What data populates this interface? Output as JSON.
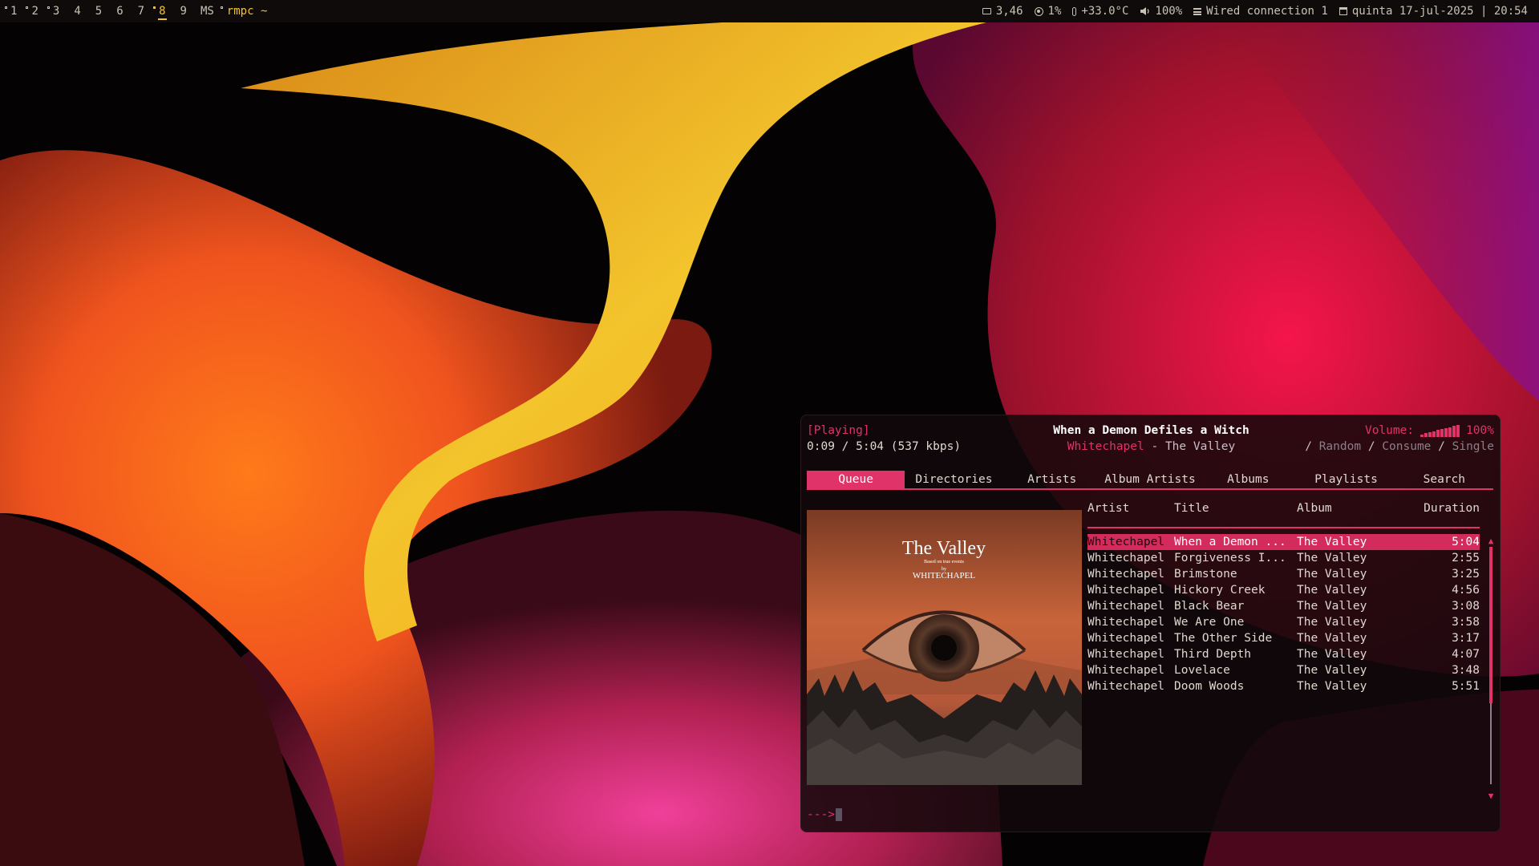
{
  "topbar": {
    "workspaces": [
      "1",
      "2",
      "3",
      "4",
      "5",
      "6",
      "7",
      "8",
      "9"
    ],
    "layout": "MS",
    "window_title": "rmpc ~",
    "memory": "3,46",
    "cpu": "1%",
    "temperature": "+33.0°C",
    "volume": "100%",
    "network": "Wired connection 1",
    "datetime": "quinta 17-jul-2025 | 20:54"
  },
  "player": {
    "state": "[Playing]",
    "elapsed": "0:09 / 5:04 (537 kbps)",
    "song_title": "When a Demon Defiles a Witch",
    "artist": "Whitechapel",
    "separator": " - ",
    "album": "The Valley",
    "volume_label": "Volume:",
    "volume_value": "100%",
    "volume_level": 1.0,
    "flags": {
      "sep": " / ",
      "random": "Random",
      "consume": "Consume",
      "single": "Single"
    }
  },
  "tabs": [
    "Queue",
    "Directories",
    "Artists",
    "Album Artists",
    "Albums",
    "Playlists",
    "Search"
  ],
  "queue": {
    "headers": {
      "artist": "Artist",
      "title": "Title",
      "album": "Album",
      "duration": "Duration"
    },
    "rows": [
      {
        "artist": "Whitechapel",
        "title": "When a Demon ...",
        "album": "The Valley",
        "duration": "5:04"
      },
      {
        "artist": "Whitechapel",
        "title": "Forgiveness I...",
        "album": "The Valley",
        "duration": "2:55"
      },
      {
        "artist": "Whitechapel",
        "title": "Brimstone",
        "album": "The Valley",
        "duration": "3:25"
      },
      {
        "artist": "Whitechapel",
        "title": "Hickory Creek",
        "album": "The Valley",
        "duration": "4:56"
      },
      {
        "artist": "Whitechapel",
        "title": "Black Bear",
        "album": "The Valley",
        "duration": "3:08"
      },
      {
        "artist": "Whitechapel",
        "title": "We Are One",
        "album": "The Valley",
        "duration": "3:58"
      },
      {
        "artist": "Whitechapel",
        "title": "The Other Side",
        "album": "The Valley",
        "duration": "3:17"
      },
      {
        "artist": "Whitechapel",
        "title": "Third Depth",
        "album": "The Valley",
        "duration": "4:07"
      },
      {
        "artist": "Whitechapel",
        "title": "Lovelace",
        "album": "The Valley",
        "duration": "3:48"
      },
      {
        "artist": "Whitechapel",
        "title": "Doom Woods",
        "album": "The Valley",
        "duration": "5:51"
      }
    ]
  },
  "album_art": {
    "title": "The Valley",
    "subtitle": "Based on true events",
    "by": "by",
    "band": "WHITECHAPEL"
  },
  "prompt": "--->",
  "colors": {
    "accent": "#e0336a",
    "workspace_active": "#f0c332"
  }
}
